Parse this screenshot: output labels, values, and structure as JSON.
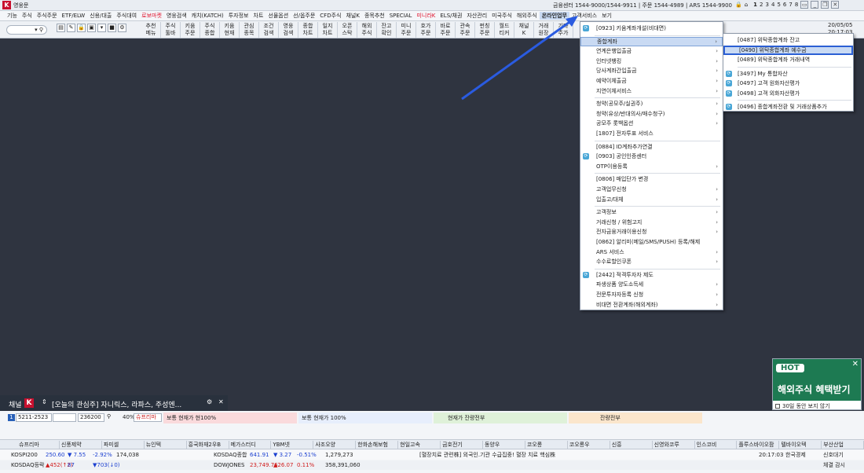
{
  "titlebar": {
    "app_title": "영웅문",
    "info": "금융센터 1544-9000/1544-9911 | 주문 1544-4989 | ARS 1544-9900",
    "pages": [
      "1",
      "2",
      "3",
      "4",
      "5",
      "6",
      "7",
      "8"
    ]
  },
  "menubar": [
    {
      "label": "기능"
    },
    {
      "label": "주식"
    },
    {
      "label": "주식주문"
    },
    {
      "label": "ETF/ELW"
    },
    {
      "label": "신용/대출"
    },
    {
      "label": "주식대여"
    },
    {
      "label": "로보마켓",
      "red": true
    },
    {
      "label": "영웅검색"
    },
    {
      "label": "캐치(KATCH)"
    },
    {
      "label": "투자정보"
    },
    {
      "label": "차트"
    },
    {
      "label": "선물옵션"
    },
    {
      "label": "선/옵주문"
    },
    {
      "label": "CFD주식"
    },
    {
      "label": "채널K"
    },
    {
      "label": "종목추천"
    },
    {
      "label": "SPECIAL"
    },
    {
      "label": "미니라K",
      "red": true
    },
    {
      "label": "ELS/채권"
    },
    {
      "label": "자산관리"
    },
    {
      "label": "미국주식"
    },
    {
      "label": "해외주식"
    },
    {
      "label": "온라인업무",
      "active": true
    },
    {
      "label": "고객서비스"
    },
    {
      "label": "보기"
    }
  ],
  "toolbar": {
    "combo_icon": "search-icon",
    "buttons": [
      [
        "추천",
        "메뉴"
      ],
      [
        "주식",
        "툴바"
      ],
      [
        "키움",
        "주문"
      ],
      [
        "주식",
        "종합"
      ],
      [
        "키움",
        "현재"
      ],
      [
        "관심",
        "종목"
      ],
      [
        "조건",
        "검색"
      ],
      [
        "영웅",
        "검색"
      ],
      [
        "종합",
        "차트"
      ],
      [
        "일지",
        "차트"
      ],
      [
        "오픈",
        "스탁"
      ],
      [
        "해외",
        "주식"
      ],
      [
        "잔고",
        "확인"
      ],
      [
        "미니",
        "주문"
      ],
      [
        "호가",
        "주문"
      ],
      [
        "바로",
        "주문"
      ],
      [
        "관속",
        "주문"
      ],
      [
        "펀칭",
        "주문"
      ],
      [
        "월드",
        "티커"
      ],
      [
        "채널",
        "K"
      ],
      [
        "거래",
        "원장"
      ],
      [
        "기타",
        "주가"
      ]
    ],
    "date": "20/05/05",
    "time": "20:17:03"
  },
  "dropdown": {
    "items": [
      {
        "label": "[0923] 키움계좌개설(비대면)",
        "icon": true
      },
      {
        "sep": true
      },
      {
        "label": "종합계좌",
        "arrow": true,
        "highlight": true
      },
      {
        "label": "연계은행입출금",
        "arrow": true
      },
      {
        "label": "인터넷뱅킹",
        "arrow": true
      },
      {
        "label": "당사계좌간입출금",
        "arrow": true
      },
      {
        "label": "예약이체출금",
        "arrow": true
      },
      {
        "label": "지연이체서비스",
        "arrow": true
      },
      {
        "sep": true
      },
      {
        "label": "청약(공모주/실권주)",
        "arrow": true
      },
      {
        "label": "청약(유상/반대의사/매수청구)",
        "arrow": true
      },
      {
        "label": "공모주 롯백옵션",
        "arrow": true
      },
      {
        "label": "[1807] 전자투표 서비스"
      },
      {
        "sep": true
      },
      {
        "label": "[0884] ID계좌추가연결"
      },
      {
        "label": "[0903] 공인인증센터",
        "icon": true
      },
      {
        "label": "OTP이용등록",
        "arrow": true
      },
      {
        "sep": true
      },
      {
        "label": "[0806] 매입단가 변경"
      },
      {
        "label": "고객업무신청",
        "arrow": true
      },
      {
        "label": "입출고/대체",
        "arrow": true
      },
      {
        "sep": true
      },
      {
        "label": "고객정보",
        "arrow": true
      },
      {
        "label": "거래신청 / 위험고지",
        "arrow": true
      },
      {
        "label": "전자금융거래이용신청",
        "arrow": true
      },
      {
        "label": "[0862] 알리미(메일/SMS/PUSH) 등록/해제"
      },
      {
        "label": "ARS 서비스",
        "arrow": true
      },
      {
        "label": "수수료할인쿠폰",
        "arrow": true
      },
      {
        "sep": true
      },
      {
        "label": "[2442] 적격투자자 제도",
        "icon": true
      },
      {
        "label": "파생상품 양도소득세",
        "arrow": true
      },
      {
        "label": "전문투자자등록 신청",
        "arrow": true
      },
      {
        "label": "비대면 전환계좌(해외계좌)",
        "arrow": true
      }
    ]
  },
  "submenu": {
    "items": [
      {
        "label": "[0487] 위탁종합계좌 잔고"
      },
      {
        "label": "[0490] 위탁종합계좌 예수금",
        "highlight": true
      },
      {
        "label": "[0489] 위탁종합계좌 거래내역"
      },
      {
        "sep": true
      },
      {
        "label": "[3497] My 통합자산",
        "icon": true
      },
      {
        "label": "[0497] 고객 원화자산평가",
        "icon": true
      },
      {
        "label": "[0498] 고객 외화자산평가",
        "icon": true
      },
      {
        "sep": true
      },
      {
        "label": "[0496] 종합계좌전환 및 거래상품추가",
        "icon": true
      }
    ]
  },
  "popup": {
    "badge": "HOT",
    "headline": "해외주식 혜택받기",
    "footer": "30일 동안 보지 않기"
  },
  "channel": {
    "label": "채널",
    "logo": "K",
    "text": "[오늘의 관심주] 자니릭스, 라파스, 주성엔..."
  },
  "ctrl": {
    "account": "5211-2523",
    "code": "236200",
    "pct": "40%",
    "name": "슈프리마",
    "seg1": "보통  현재가  현100%",
    "seg2": "보통  현재가  100%",
    "seg3": "현재가  잔량전부",
    "seg4": "잔량전부"
  },
  "watchlist": [
    "슈프리마",
    "신풍제약",
    "파미셀",
    "뉴인텍",
    "흥국화재2우B",
    "메가스터디",
    "YBM넷",
    "사조오양",
    "한화손해보험",
    "현일고속",
    "금호전기",
    "동양우",
    "코오롱",
    "코오롱우",
    "신흥",
    "신영와코루",
    "인스코비",
    "플루스바이오팜",
    "텔바이오텍",
    "부산산업"
  ],
  "indices": [
    {
      "name": "KOSPI200",
      "v": "250.60",
      "c": "▼ 7.55",
      "p": "-2.92%",
      "vol": "174,038",
      "name2": "KOSDAQ종합",
      "v2": "641.91",
      "c2": "▼ 3.27",
      "p2": "-0.51%",
      "vol2": "1,279,273",
      "news": "[혈장치료 관련株] 외국인.기관 수급집중! 혈장 치료 핵심株",
      "time": "20:17:03",
      "src": "한국경제",
      "btn": "신호대기"
    },
    {
      "name": "KOSDAQ등락",
      "v": "▲452(↑2)",
      "c": "87",
      "p": "▼703(↓0)",
      "vol": "",
      "name2": "DOWJONES",
      "v2": "23,749.76",
      "c2": "▲26.07",
      "p2": "0.11%",
      "vol2": "358,391,060",
      "news": "",
      "time": "",
      "src": "",
      "btn": "체결  감시"
    }
  ]
}
